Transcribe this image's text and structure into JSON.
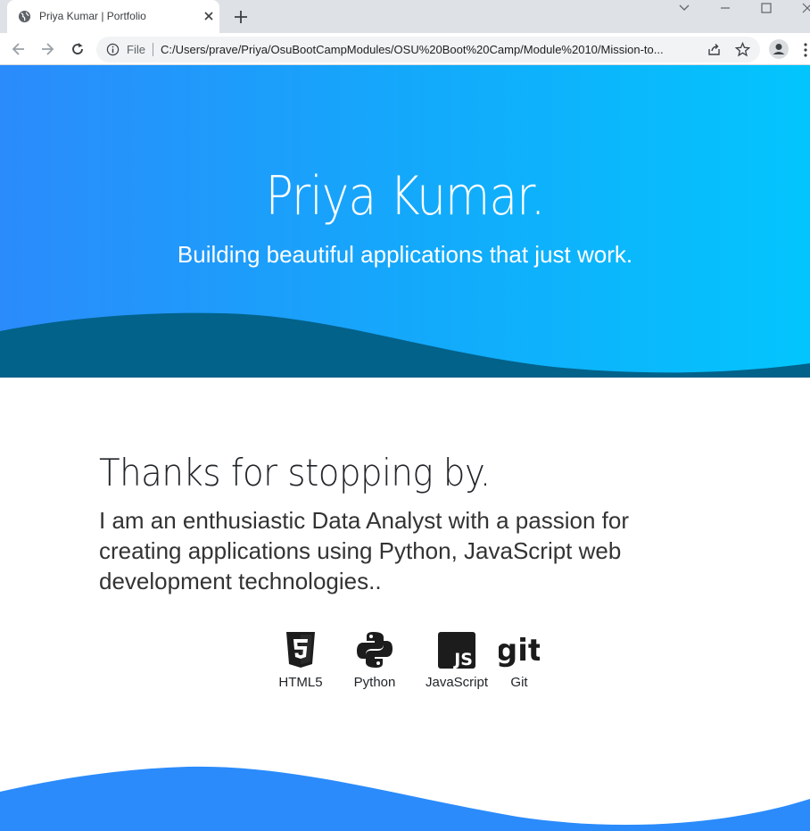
{
  "browser": {
    "tab_title": "Priya Kumar | Portfolio",
    "url_scheme": "File",
    "url": "C:/Users/prave/Priya/OsuBootCampModules/OSU%20Boot%20Camp/Module%2010/Mission-to..."
  },
  "hero": {
    "title": "Priya Kumar.",
    "subtitle": "Building beautiful applications that just work."
  },
  "about": {
    "heading": "Thanks for stopping by.",
    "text": "I am an enthusiastic Data Analyst with a passion for creating applications using Python, JavaScript web development technologies.."
  },
  "skills": [
    {
      "label": "HTML5",
      "icon": "html5-icon"
    },
    {
      "label": "Python",
      "icon": "python-icon"
    },
    {
      "label": "JavaScript",
      "icon": "javascript-icon"
    },
    {
      "label": "Git",
      "icon": "git-icon"
    }
  ],
  "colors": {
    "hero_gradient_start": "#2b8bfb",
    "hero_gradient_end": "#03c5fd",
    "hero_wave": "#02628a",
    "footer_wave": "#2b8bfb"
  }
}
